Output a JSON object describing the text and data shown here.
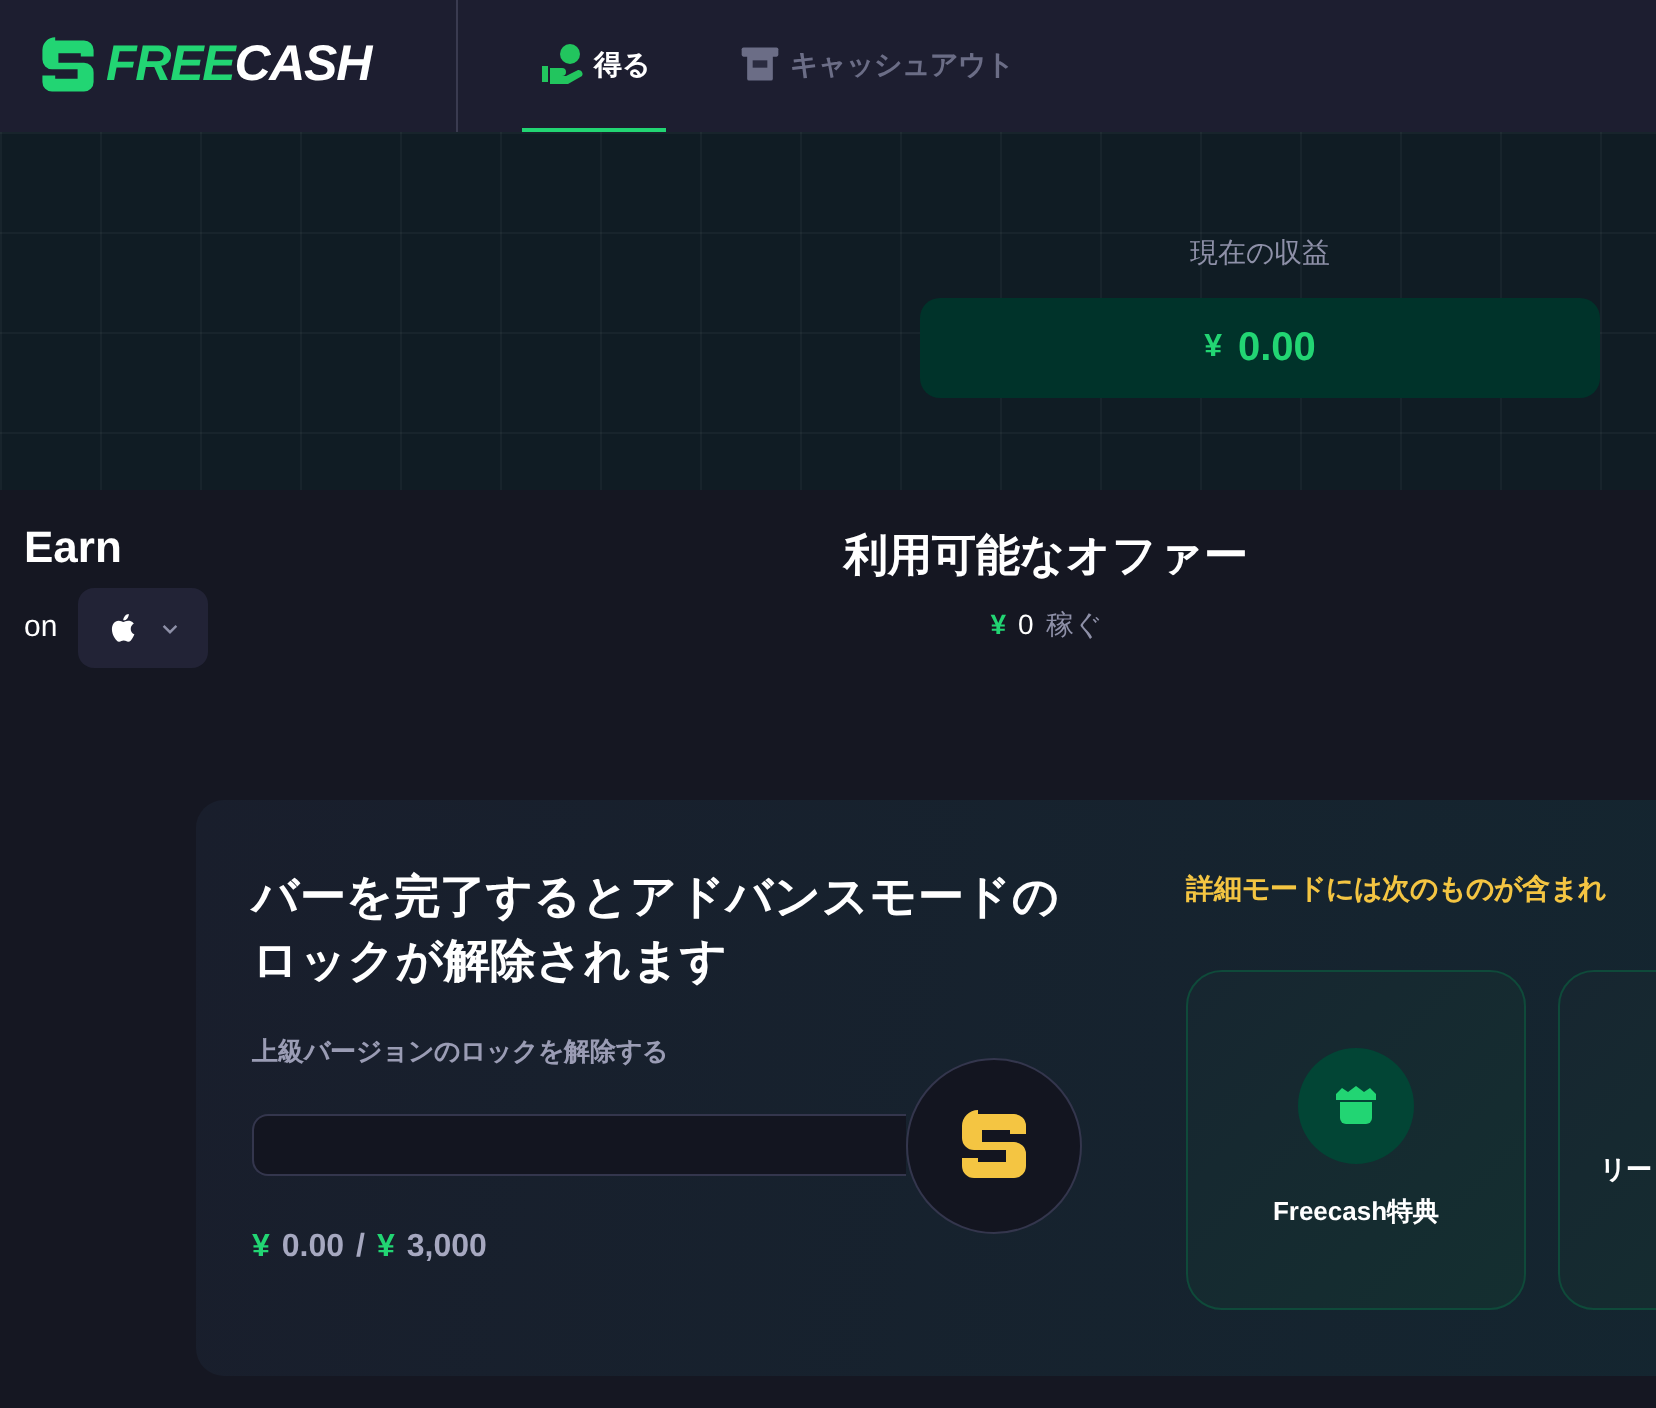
{
  "header": {
    "logo": {
      "part_1": "FREE",
      "part_2": "CASH"
    },
    "tabs": [
      {
        "label": "得る",
        "selected": true
      },
      {
        "label": "キャッシュアウト",
        "selected": false
      }
    ]
  },
  "earnings": {
    "label": "現在の収益",
    "currency": "¥",
    "amount": "0.00"
  },
  "earn": {
    "title": "Earn",
    "on": "on"
  },
  "offers": {
    "title": "利用可能なオファー",
    "currency": "¥",
    "amount": "0",
    "suffix": "稼ぐ"
  },
  "unlock": {
    "title": "バーを完了するとアドバンスモードのロックが解除されます",
    "bar_label": "上級バージョンのロックを解除する",
    "level": 0,
    "progress": {
      "currency_1": "¥",
      "current": "0.00",
      "separator": "/",
      "currency_2": "¥",
      "target": "3,000"
    },
    "features_title": "詳細モードには次のものが含まれ",
    "features": [
      {
        "label": "Freecash特典"
      },
      {
        "label": "リー"
      }
    ]
  }
}
